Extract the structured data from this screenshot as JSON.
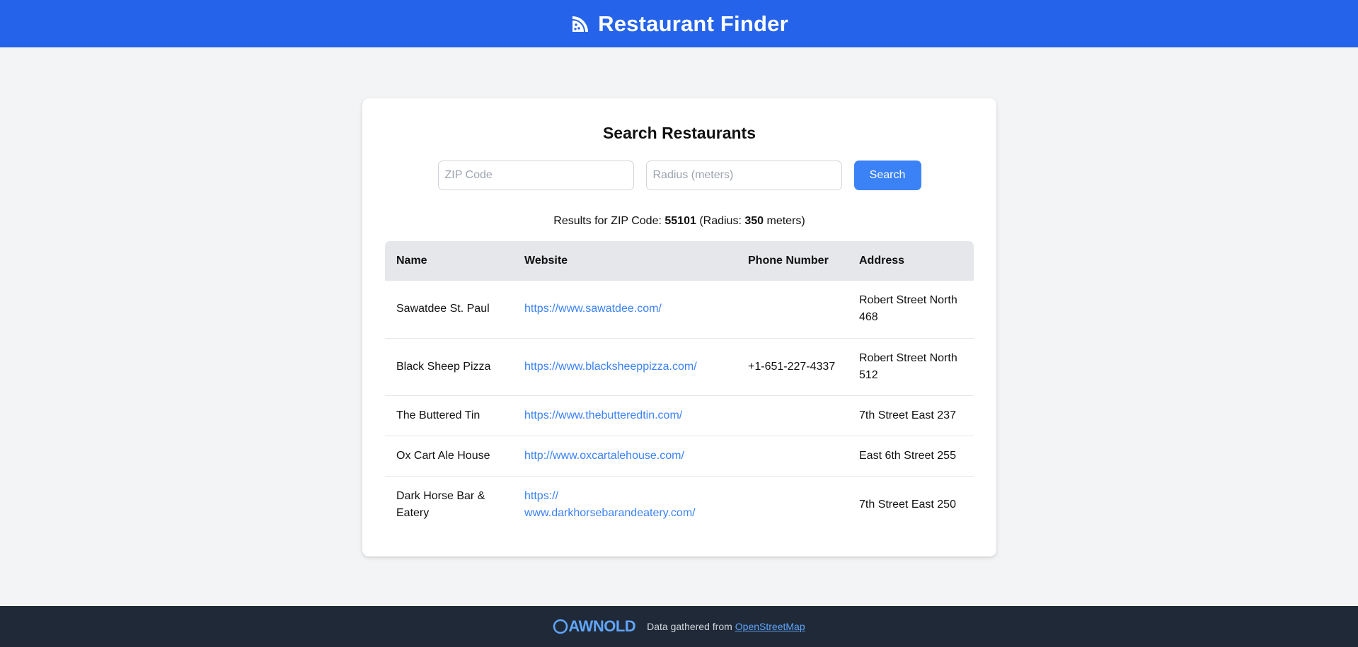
{
  "header": {
    "title": "Restaurant Finder",
    "icon": "pizza-icon",
    "color": "#2563eb"
  },
  "search": {
    "heading": "Search Restaurants",
    "zip_placeholder": "ZIP Code",
    "zip_value": "",
    "radius_placeholder": "Radius (meters)",
    "radius_value": "",
    "button_label": "Search"
  },
  "results": {
    "prefix": "Results for ZIP Code: ",
    "zip": "55101",
    "radius_prefix": " (Radius: ",
    "radius": "350",
    "suffix": " meters)"
  },
  "table": {
    "headers": [
      "Name",
      "Website",
      "Phone Number",
      "Address"
    ],
    "rows": [
      {
        "name": "Sawatdee St. Paul",
        "website": "https://www.sawatdee.com/",
        "phone": "",
        "address": "Robert Street North 468"
      },
      {
        "name": "Black Sheep Pizza",
        "website": "https://www.blacksheeppizza.com/",
        "phone": "+1-651-227-4337",
        "address": "Robert Street North 512"
      },
      {
        "name": "The Buttered Tin",
        "website": "https://www.thebutteredtin.com/",
        "phone": "",
        "address": "7th Street East 237"
      },
      {
        "name": "Ox Cart Ale House",
        "website": "http://www.oxcartalehouse.com/",
        "phone": "",
        "address": "East 6th Street 255"
      },
      {
        "name": "Dark Horse Bar & Eatery",
        "website": "https://\nwww.darkhorsebarandeatery.com/",
        "phone": "",
        "address": "7th Street East 250"
      }
    ]
  },
  "footer": {
    "brand": "AWNOLD",
    "brand_icon": "github-icon",
    "text": "Data gathered from",
    "link": "OpenStreetMap"
  },
  "colors": {
    "accent": "#3b82f6",
    "footer_bg": "#1f2937",
    "page_bg": "#f3f4f6"
  }
}
